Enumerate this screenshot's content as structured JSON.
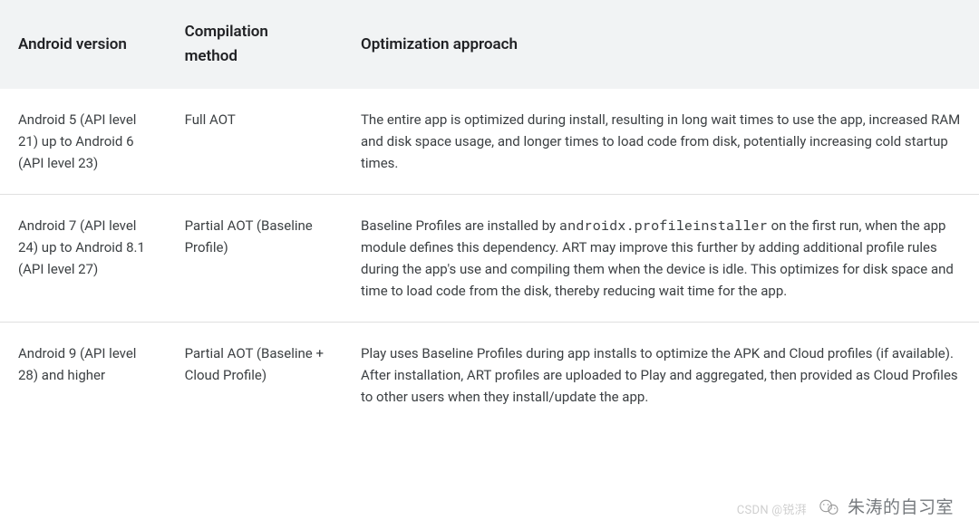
{
  "table": {
    "headers": [
      "Android version",
      "Compilation method",
      "Optimization approach"
    ],
    "rows": [
      {
        "version": "Android 5 (API level 21) up to Android 6 (API level 23)",
        "method": "Full AOT",
        "approach_pre": "The entire app is optimized during install, resulting in long wait times to use the app, increased RAM and disk space usage, and longer times to load code from disk, potentially increasing cold startup times.",
        "approach_code": "",
        "approach_post": ""
      },
      {
        "version": "Android 7 (API level 24) up to Android 8.1 (API level 27)",
        "method": "Partial AOT (Baseline Profile)",
        "approach_pre": "Baseline Profiles are installed by ",
        "approach_code": "androidx.profileinstaller",
        "approach_post": " on the first run, when the app module defines this dependency. ART may improve this further by adding additional profile rules during the app's use and compiling them when the device is idle. This optimizes for disk space and time to load code from the disk, thereby reducing wait time for the app."
      },
      {
        "version": "Android 9 (API level 28) and higher",
        "method": "Partial AOT (Baseline + Cloud Profile)",
        "approach_pre": "Play uses Baseline Profiles during app installs to optimize the APK and Cloud profiles (if available). After installation, ART profiles are uploaded to Play and aggregated, then provided as Cloud Profiles to other users when they install/update the app.",
        "approach_code": "",
        "approach_post": ""
      }
    ]
  },
  "watermarks": {
    "csdn": "CSDN @锐湃",
    "study_room": "朱涛的自习室"
  }
}
